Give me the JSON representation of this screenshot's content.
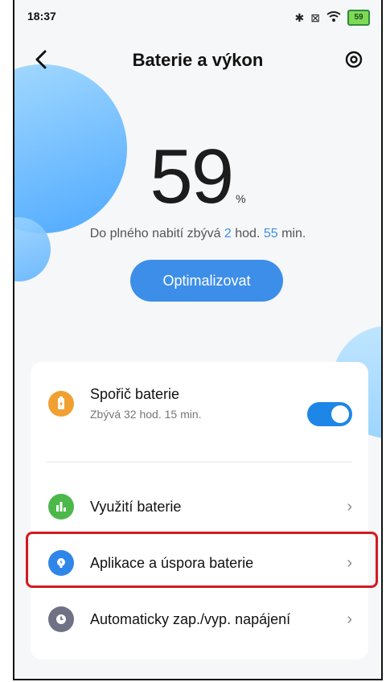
{
  "status_bar": {
    "time": "18:37",
    "icons": [
      "bluetooth-icon",
      "dnd-icon",
      "wifi-icon",
      "battery-icon"
    ],
    "battery_level": "59"
  },
  "header": {
    "title": "Baterie a výkon"
  },
  "battery": {
    "percent": "59",
    "percent_symbol": "%",
    "charge_prefix": "Do plného nabití zbývá ",
    "hours": "2",
    "hours_unit": " hod. ",
    "minutes": "55",
    "minutes_unit": " min.",
    "optimize_button": "Optimalizovat"
  },
  "settings": {
    "saver": {
      "label": "Spořič baterie",
      "sub": "Zbývá 32 hod. 15 min.",
      "enabled": true,
      "icon_color": "#f0a030"
    },
    "usage": {
      "label": "Využití baterie",
      "icon_color": "#4cb84a"
    },
    "apps": {
      "label": "Aplikace a úspora baterie",
      "icon_color": "#2f86e8"
    },
    "schedule": {
      "label": "Automaticky zap./vyp. napájení",
      "icon_color": "#6f7285"
    }
  },
  "colors": {
    "accent": "#3d8ee9",
    "toggle": "#1e86e6",
    "highlight": "#d21a22"
  }
}
